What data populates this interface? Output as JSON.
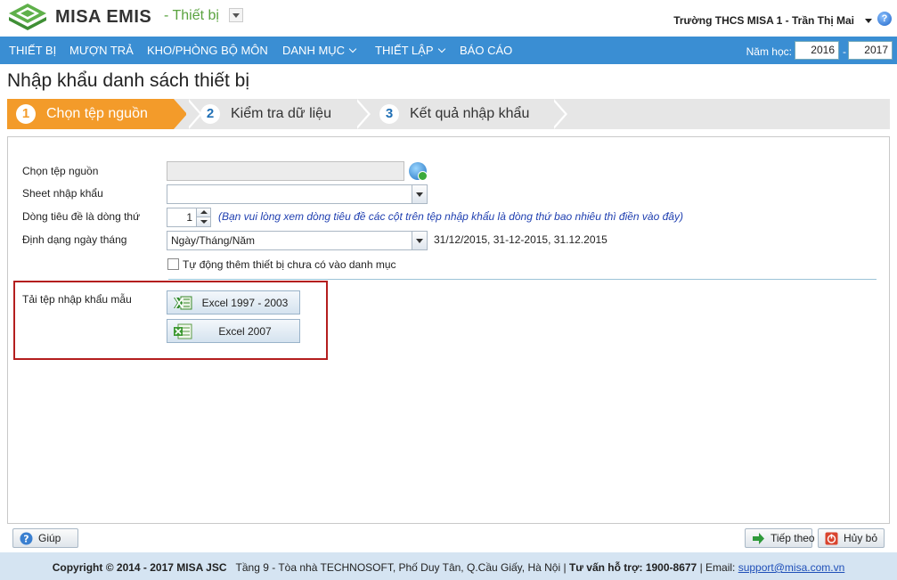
{
  "header": {
    "brand": "MISA EMIS",
    "module": "- Thiết bị",
    "user": "Trường THCS MISA 1 - Trần Thị Mai"
  },
  "menu": {
    "items": [
      {
        "label": "THIẾT BỊ",
        "dropdown": false
      },
      {
        "label": "MƯỢN TRẢ",
        "dropdown": false
      },
      {
        "label": "KHO/PHÒNG BỘ MÔN",
        "dropdown": false
      },
      {
        "label": "DANH MỤC",
        "dropdown": true
      },
      {
        "label": "THIẾT LẬP",
        "dropdown": true
      },
      {
        "label": "BÁO CÁO",
        "dropdown": false
      }
    ],
    "year_label": "Năm học:",
    "year_from": "2016",
    "year_sep": "-",
    "year_to": "2017"
  },
  "page_title": "Nhập khẩu danh sách thiết bị",
  "wizard": {
    "steps": [
      {
        "num": "1",
        "label": "Chọn tệp nguồn",
        "active": true
      },
      {
        "num": "2",
        "label": "Kiểm tra dữ liệu",
        "active": false
      },
      {
        "num": "3",
        "label": "Kết quả nhập khẩu",
        "active": false
      }
    ]
  },
  "form": {
    "source_file_label": "Chọn tệp nguồn",
    "source_file_value": "",
    "sheet_label": "Sheet nhập khẩu",
    "sheet_value": "",
    "header_row_label": "Dòng tiêu đề là dòng thứ",
    "header_row_value": "1",
    "header_row_hint": "(Bạn vui lòng xem dòng tiêu đề các cột trên tệp nhập khẩu là dòng thứ bao nhiêu thì điền vào đây)",
    "date_format_label": "Định dạng ngày tháng",
    "date_format_value": "Ngày/Tháng/Năm",
    "date_format_examples": "31/12/2015, 31-12-2015, 31.12.2015",
    "auto_add_label": "Tự động thêm thiết bị chưa có vào danh mục",
    "auto_add_checked": false,
    "template_label": "Tải tệp nhập khẩu mẫu",
    "excel_2003_label": "Excel 1997 - 2003",
    "excel_2007_label": "Excel 2007"
  },
  "actions": {
    "help": "Giúp",
    "next": "Tiếp theo",
    "cancel": "Hủy bỏ"
  },
  "footer": {
    "copyright": "Copyright © 2014 - 2017 MISA JSC",
    "address": "Tầng 9 - Tòa nhà TECHNOSOFT, Phố Duy Tân, Q.Cầu Giấy, Hà Nội",
    "sep": "|",
    "hotline": "Tư vấn hỗ trợ: 1900-8677",
    "email_label": "| Email:",
    "email": "support@misa.com.vn"
  },
  "colors": {
    "menu_bg": "#3a8ed3",
    "step_active": "#f39b2a",
    "highlight_border": "#b41e1e",
    "footer_bg": "#d5e4f2"
  }
}
